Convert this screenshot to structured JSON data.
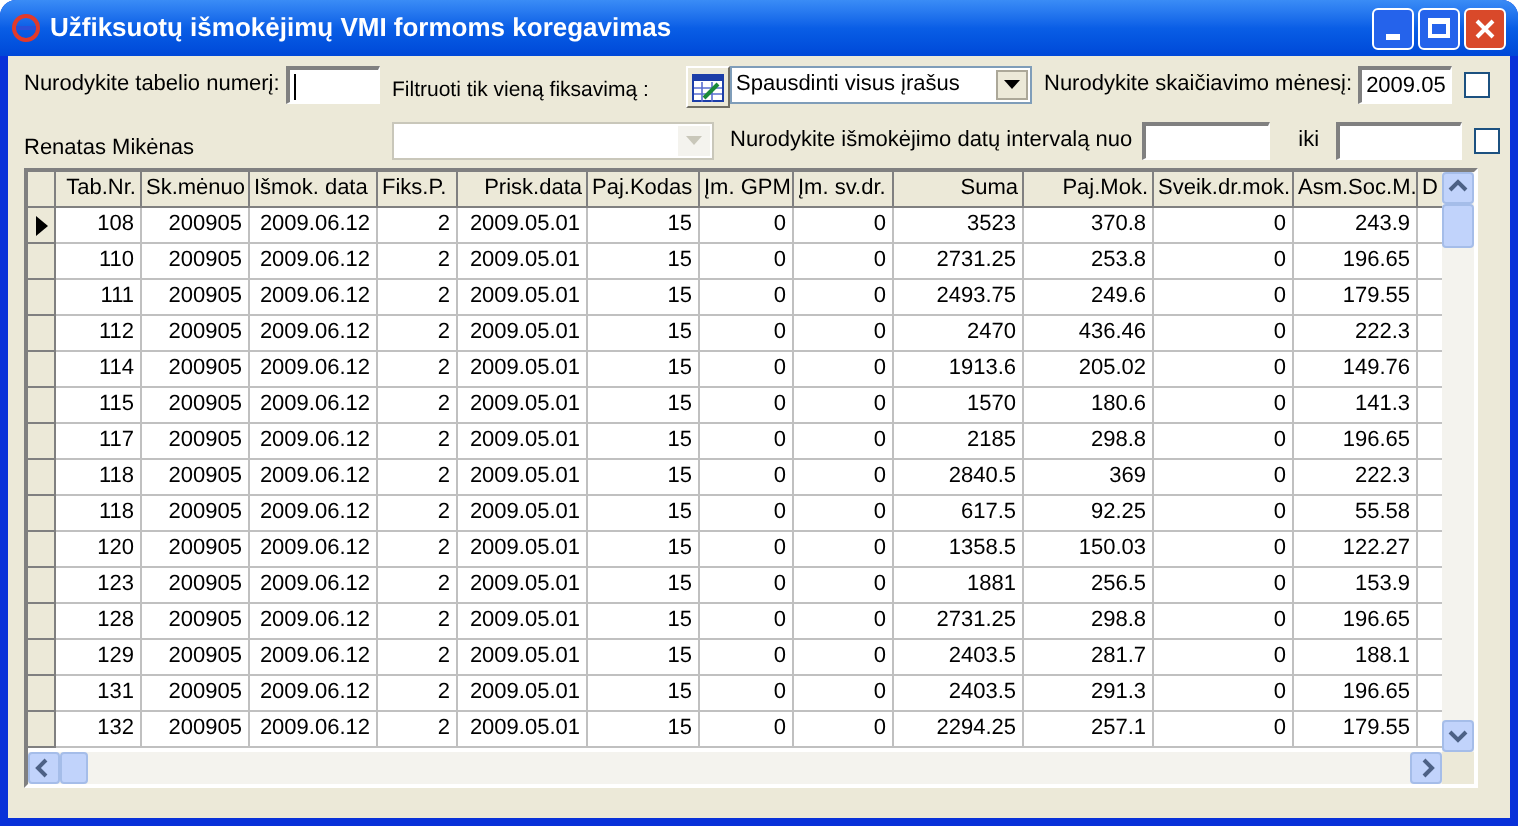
{
  "window": {
    "title": "Užfiksuotų išmokėjimų VMI formoms koregavimas"
  },
  "form": {
    "tabelio_label": "Nurodykite tabelio numerį:",
    "employee_name": "Renatas Mikėnas",
    "filter_label": "Filtruoti tik vieną fiksavimą :",
    "filter_dropdown": {
      "disabled": true
    },
    "print_combo": {
      "value": "Spausdinti visus įrašus"
    },
    "month_label": "Nurodykite skaičiavimo mėnesį:",
    "month_value": "2009.05",
    "month_checked": false,
    "interval_label": "Nurodykite išmokėjimo datų intervalą nuo",
    "iki_label": "iki",
    "interval_checked": false
  },
  "table": {
    "columns": [
      "Tab.Nr.",
      "Sk.mėnuo",
      "Išmok. data",
      "Fiks.P.",
      "Prisk.data",
      "Paj.Kodas",
      "Įm. GPM",
      "Įm. sv.dr.",
      "Suma",
      "Paj.Mok.",
      "Sveik.dr.mok.",
      "Asm.Soc.M.",
      "D"
    ],
    "rows": [
      {
        "selected": true,
        "cells": [
          "108",
          "200905",
          "2009.06.12",
          "2",
          "2009.05.01",
          "15",
          "0",
          "0",
          "3523",
          "370.8",
          "0",
          "243.9"
        ]
      },
      {
        "selected": false,
        "cells": [
          "110",
          "200905",
          "2009.06.12",
          "2",
          "2009.05.01",
          "15",
          "0",
          "0",
          "2731.25",
          "253.8",
          "0",
          "196.65"
        ]
      },
      {
        "selected": false,
        "cells": [
          "111",
          "200905",
          "2009.06.12",
          "2",
          "2009.05.01",
          "15",
          "0",
          "0",
          "2493.75",
          "249.6",
          "0",
          "179.55"
        ]
      },
      {
        "selected": false,
        "cells": [
          "112",
          "200905",
          "2009.06.12",
          "2",
          "2009.05.01",
          "15",
          "0",
          "0",
          "2470",
          "436.46",
          "0",
          "222.3"
        ]
      },
      {
        "selected": false,
        "cells": [
          "114",
          "200905",
          "2009.06.12",
          "2",
          "2009.05.01",
          "15",
          "0",
          "0",
          "1913.6",
          "205.02",
          "0",
          "149.76"
        ]
      },
      {
        "selected": false,
        "cells": [
          "115",
          "200905",
          "2009.06.12",
          "2",
          "2009.05.01",
          "15",
          "0",
          "0",
          "1570",
          "180.6",
          "0",
          "141.3"
        ]
      },
      {
        "selected": false,
        "cells": [
          "117",
          "200905",
          "2009.06.12",
          "2",
          "2009.05.01",
          "15",
          "0",
          "0",
          "2185",
          "298.8",
          "0",
          "196.65"
        ]
      },
      {
        "selected": false,
        "cells": [
          "118",
          "200905",
          "2009.06.12",
          "2",
          "2009.05.01",
          "15",
          "0",
          "0",
          "2840.5",
          "369",
          "0",
          "222.3"
        ]
      },
      {
        "selected": false,
        "cells": [
          "118",
          "200905",
          "2009.06.12",
          "2",
          "2009.05.01",
          "15",
          "0",
          "0",
          "617.5",
          "92.25",
          "0",
          "55.58"
        ]
      },
      {
        "selected": false,
        "cells": [
          "120",
          "200905",
          "2009.06.12",
          "2",
          "2009.05.01",
          "15",
          "0",
          "0",
          "1358.5",
          "150.03",
          "0",
          "122.27"
        ]
      },
      {
        "selected": false,
        "cells": [
          "123",
          "200905",
          "2009.06.12",
          "2",
          "2009.05.01",
          "15",
          "0",
          "0",
          "1881",
          "256.5",
          "0",
          "153.9"
        ]
      },
      {
        "selected": false,
        "cells": [
          "128",
          "200905",
          "2009.06.12",
          "2",
          "2009.05.01",
          "15",
          "0",
          "0",
          "2731.25",
          "298.8",
          "0",
          "196.65"
        ]
      },
      {
        "selected": false,
        "cells": [
          "129",
          "200905",
          "2009.06.12",
          "2",
          "2009.05.01",
          "15",
          "0",
          "0",
          "2403.5",
          "281.7",
          "0",
          "188.1"
        ]
      },
      {
        "selected": false,
        "cells": [
          "131",
          "200905",
          "2009.06.12",
          "2",
          "2009.05.01",
          "15",
          "0",
          "0",
          "2403.5",
          "291.3",
          "0",
          "196.65"
        ]
      },
      {
        "selected": false,
        "cells": [
          "132",
          "200905",
          "2009.06.12",
          "2",
          "2009.05.01",
          "15",
          "0",
          "0",
          "2294.25",
          "257.1",
          "0",
          "179.55"
        ]
      }
    ]
  }
}
